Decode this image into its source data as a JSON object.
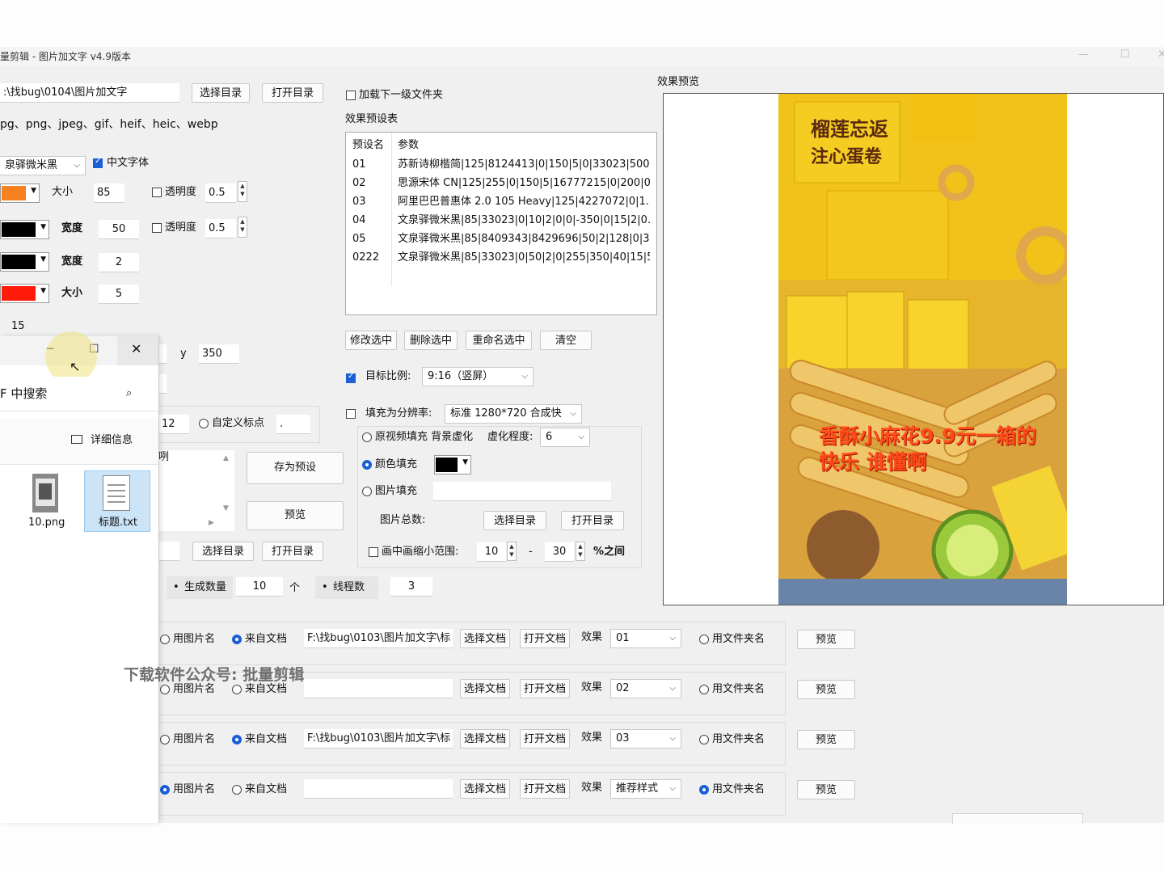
{
  "window": {
    "title": "量剪辑 - 图片加文字 v4.9版本",
    "minimize_glyph": "—",
    "maximize_glyph": "☐",
    "close_glyph": "✕"
  },
  "top": {
    "dir_path": ":\\找bug\\0104\\图片加文字",
    "select_dir_label": "选择目录",
    "open_dir_label": "打开目录",
    "formats": "pg、png、jpeg、gif、heif、heic、webp",
    "load_subfolder_label": "加载下一级文件夹"
  },
  "font": {
    "name": "泉驿微米黑",
    "chinese_font_label": "中文字体",
    "text_color": "#f5821f",
    "size_label": "大小",
    "size_value": "85",
    "opacity_label": "透明度",
    "opacity_value": "0.5"
  },
  "stroke": {
    "color": "#000000",
    "width_label": "宽度",
    "width_value": "50",
    "opacity_label": "透明度",
    "opacity_value": "0.5"
  },
  "border": {
    "color": "#000000",
    "width_label": "宽度",
    "width_value": "2"
  },
  "shadow": {
    "color": "#ff1a0a",
    "size_label": "大小",
    "size_value": "5"
  },
  "misc": {
    "spacing_value": "15",
    "y_label": "y",
    "y_value": "350",
    "pos_value": "12",
    "custom_point_label": "自定义标点",
    "custom_point_value": ".",
    "text_fragment": "咧"
  },
  "presets": {
    "section_label": "效果预设表",
    "col_name": "预设名",
    "col_params": "参数",
    "rows": [
      {
        "name": "01",
        "params": "苏新诗柳楷简|125|8124413|0|150|5|0|33023|500|..."
      },
      {
        "name": "02",
        "params": "思源宋体 CN|125|255|0|150|5|16777215|0|200|0|..."
      },
      {
        "name": "03",
        "params": "阿里巴巴普惠体 2.0 105 Heavy|125|4227072|0|1..."
      },
      {
        "name": "04",
        "params": "文泉驿微米黑|85|33023|0|10|2|0|0|-350|0|15|2|0...."
      },
      {
        "name": "05",
        "params": "文泉驿微米黑|85|8409343|8429696|50|2|128|0|3..."
      },
      {
        "name": "0222",
        "params": "文泉驿微米黑|85|33023|0|50|2|0|255|350|40|15|5|..."
      }
    ],
    "modify_label": "修改选中",
    "delete_label": "删除选中",
    "rename_label": "重命名选中",
    "clear_label": "清空",
    "save_preset_label": "存为预设",
    "preview_label": "预览"
  },
  "ratio": {
    "label": "目标比例:",
    "value": "9:16（竖屏）"
  },
  "fill": {
    "label": "填充为分辨率:",
    "value": "标准 1280*720 合成快",
    "blur_option": "原视频填充 背景虚化",
    "blur_level_label": "虚化程度:",
    "blur_level_value": "6",
    "color_option": "颜色填充",
    "color_value": "#000000",
    "image_option": "图片填充",
    "image_total_label": "图片总数:",
    "select_dir_label": "选择目录",
    "open_dir_label": "打开目录",
    "pip_label": "画中画缩小范围:",
    "pip_min": "10",
    "pip_dash": "-",
    "pip_max": "30",
    "pip_unit": "%之间"
  },
  "output": {
    "select_dir_label": "选择目录",
    "open_dir_label": "打开目录",
    "count_label": "生成数量",
    "count_value": "10",
    "count_unit": "个",
    "threads_label": "线程数",
    "threads_value": "3"
  },
  "preview": {
    "section_label": "效果预览",
    "overlay_line1": "香酥小麻花9.9元一箱的",
    "overlay_line2": "快乐 谁懂啊",
    "box_text_1": "榴莲忘返",
    "box_text_2": "注心蛋卷"
  },
  "explorer": {
    "search_placeholder": "F 中搜索",
    "details_label": "详细信息",
    "file1": "10.png",
    "file2": "标题.txt"
  },
  "text_rows": [
    {
      "opt_image_name": "用图片名",
      "opt_doc": "来自文档",
      "path": "F:\\找bug\\0103\\图片加文字\\标",
      "select_doc": "选择文档",
      "open_doc": "打开文档",
      "effect_label": "效果",
      "effect_value": "01",
      "opt_folder": "用文件夹名",
      "preview": "预览",
      "selected": "doc"
    },
    {
      "opt_image_name": "用图片名",
      "opt_doc": "来自文档",
      "path": "",
      "select_doc": "选择文档",
      "open_doc": "打开文档",
      "effect_label": "效果",
      "effect_value": "02",
      "opt_folder": "用文件夹名",
      "preview": "预览",
      "selected": "none"
    },
    {
      "opt_image_name": "用图片名",
      "opt_doc": "来自文档",
      "path": "F:\\找bug\\0103\\图片加文字\\标",
      "select_doc": "选择文档",
      "open_doc": "打开文档",
      "effect_label": "效果",
      "effect_value": "03",
      "opt_folder": "用文件夹名",
      "preview": "预览",
      "selected": "doc"
    },
    {
      "opt_image_name": "用图片名",
      "opt_doc": "来自文档",
      "path": "",
      "select_doc": "选择文档",
      "open_doc": "打开文档",
      "effect_label": "效果",
      "effect_value": "推荐样式",
      "opt_folder": "用文件夹名",
      "preview": "预览",
      "selected": "image_and_folder"
    }
  ],
  "watermark": "下载软件公众号: 批量剪辑"
}
